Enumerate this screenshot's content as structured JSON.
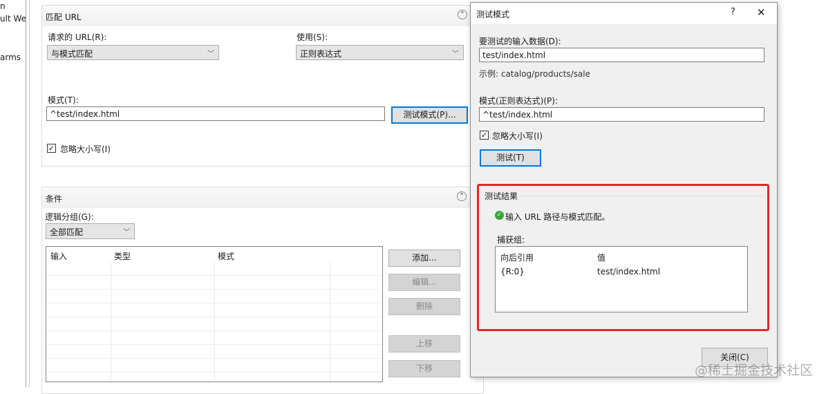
{
  "sidebar": {
    "items": [
      "n",
      "ult Wel",
      "arms"
    ]
  },
  "match_url": {
    "title": "匹配 URL",
    "requested_url_label": "请求的 URL(R):",
    "requested_url_value": "与模式匹配",
    "using_label": "使用(S):",
    "using_value": "正则表达式",
    "pattern_label": "模式(T):",
    "pattern_value": "^test/index.html",
    "test_pattern_button": "测试模式(P)...",
    "ignore_case_label": "忽略大小写(I)",
    "ignore_case_checked": true
  },
  "conditions": {
    "title": "条件",
    "logical_grouping_label": "逻辑分组(G):",
    "logical_grouping_value": "全部匹配",
    "columns": [
      "输入",
      "类型",
      "模式"
    ],
    "buttons": {
      "add": "添加...",
      "edit": "编辑...",
      "remove": "删除",
      "move_up": "上移",
      "move_down": "下移"
    }
  },
  "dialog": {
    "title": "测试模式",
    "help": "?",
    "close_x": "✕",
    "input_label": "要测试的输入数据(D):",
    "input_value": "test/index.html",
    "example": "示例: catalog/products/sale",
    "pattern_label": "模式(正则表达式)(P):",
    "pattern_value": "^test/index.html",
    "ignore_case_label": "忽略大小写(I)",
    "ignore_case_checked": true,
    "test_button": "测试(T)",
    "results_title": "测试结果",
    "result_message": "输入 URL 路径与模式匹配。",
    "capture_label": "捕获组:",
    "capture_columns": [
      "向后引用",
      "值"
    ],
    "capture_rows": [
      {
        "ref": "{R:0}",
        "value": "test/index.html"
      }
    ],
    "close_button": "关闭(C)",
    "highlight_color": "#e8262a",
    "success_color": "#3aa53a"
  },
  "watermark": "@稀土掘金技术社区"
}
